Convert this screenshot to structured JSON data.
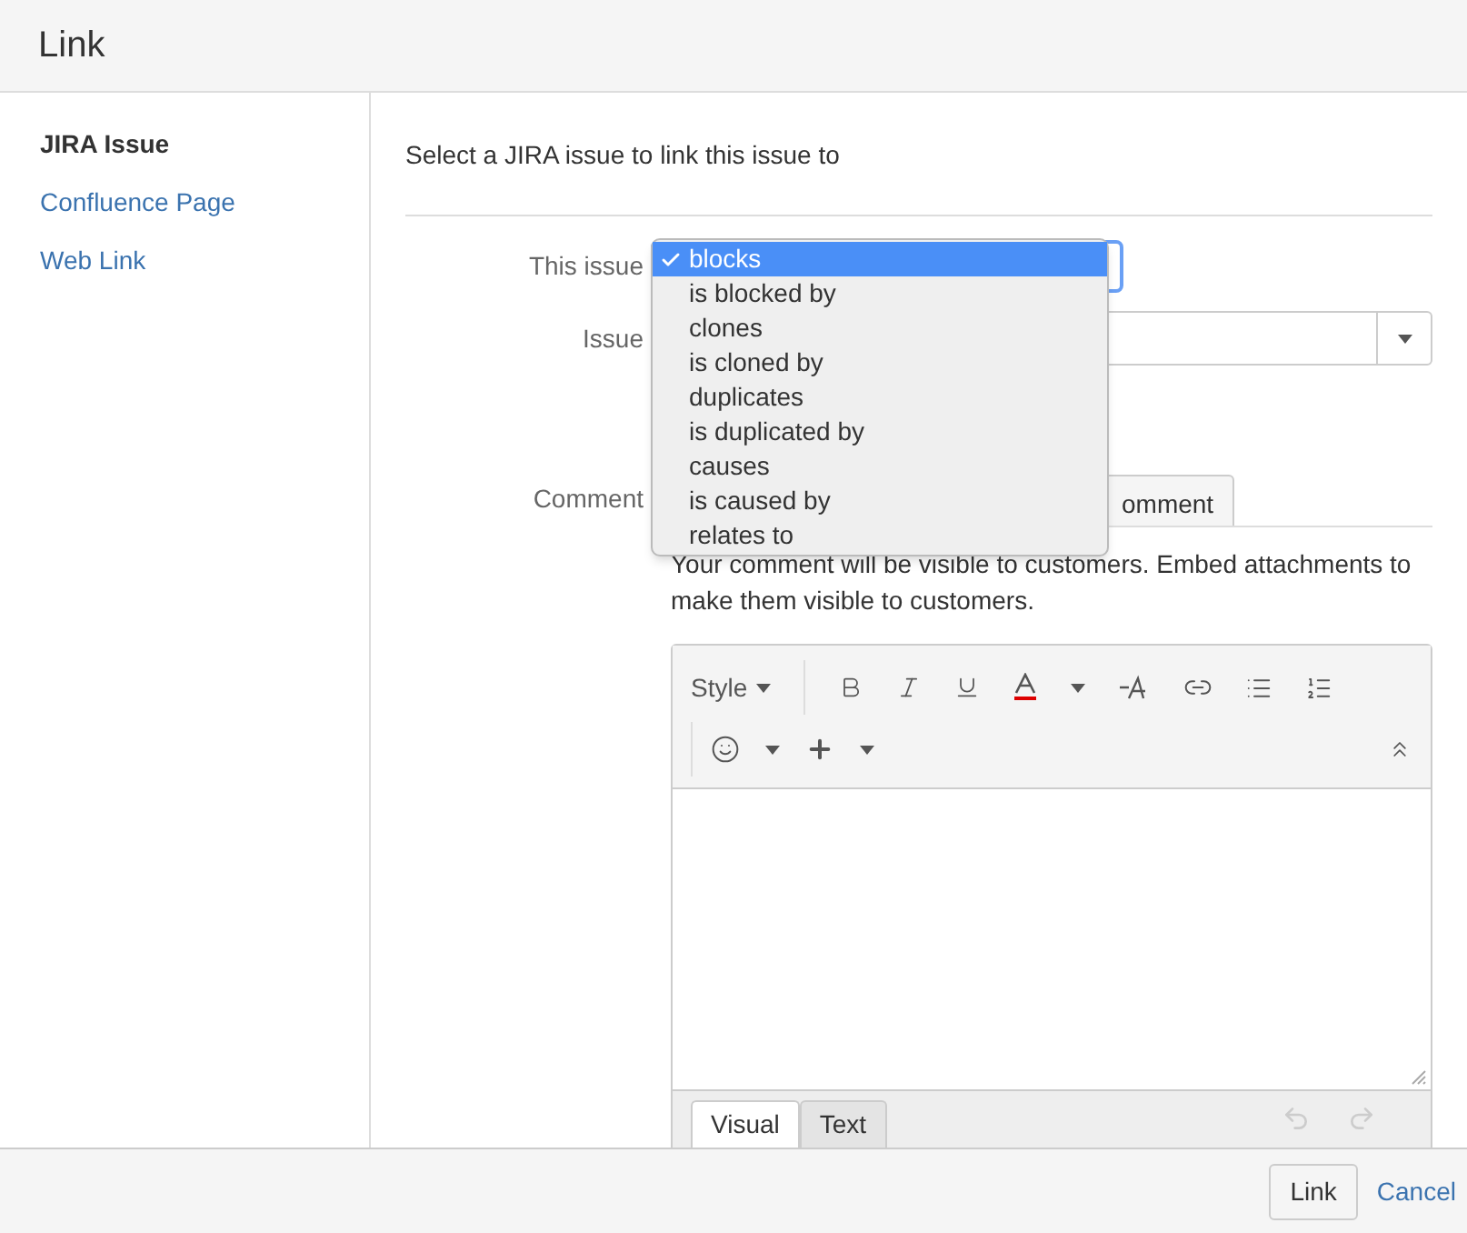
{
  "dialog": {
    "title": "Link"
  },
  "sidebar": {
    "items": [
      {
        "label": "JIRA Issue",
        "selected": true
      },
      {
        "label": "Confluence Page",
        "selected": false
      },
      {
        "label": "Web Link",
        "selected": false
      }
    ]
  },
  "intro": "Select a JIRA issue to link this issue to",
  "form": {
    "this_issue_label": "This issue",
    "issue_label": "Issue",
    "comment_label": "Comment",
    "relation_options": [
      {
        "label": "blocks",
        "selected": true
      },
      {
        "label": "is blocked by",
        "selected": false
      },
      {
        "label": "clones",
        "selected": false
      },
      {
        "label": "is cloned by",
        "selected": false
      },
      {
        "label": "duplicates",
        "selected": false
      },
      {
        "label": "is duplicated by",
        "selected": false
      },
      {
        "label": "causes",
        "selected": false
      },
      {
        "label": "is caused by",
        "selected": false
      },
      {
        "label": "relates to",
        "selected": false
      }
    ],
    "comment_tab": "omment",
    "comment_note": "Your comment will be visible to customers. Embed attachments to make them visible to customers.",
    "editor": {
      "style_label": "Style",
      "tabs": [
        {
          "label": "Visual",
          "selected": true
        },
        {
          "label": "Text",
          "selected": false
        }
      ]
    }
  },
  "footer": {
    "primary": "Link",
    "cancel": "Cancel"
  }
}
